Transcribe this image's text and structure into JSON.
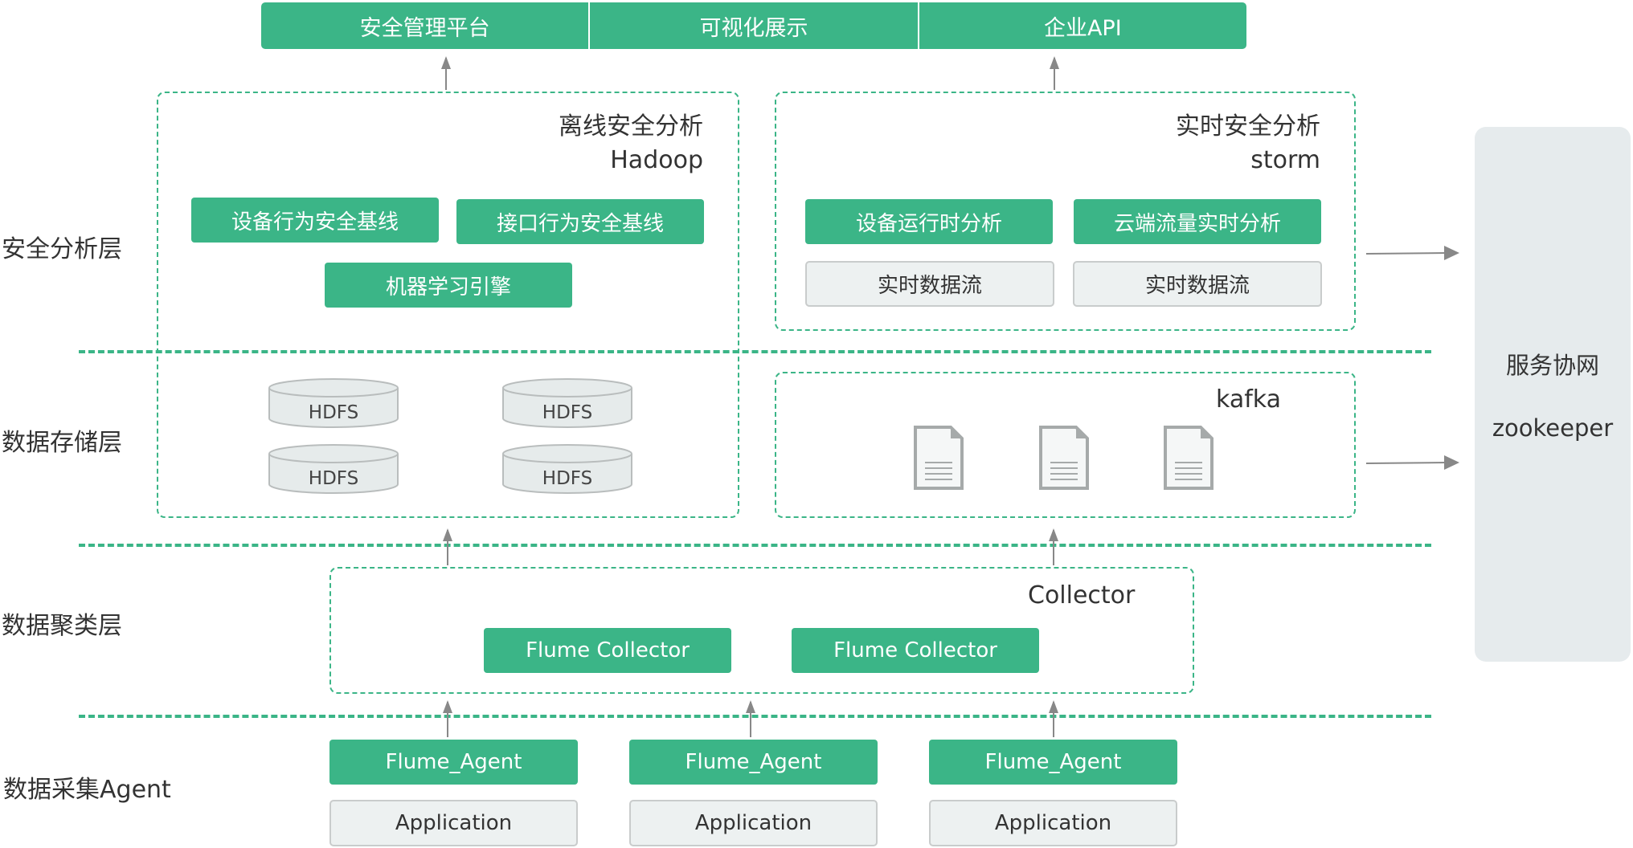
{
  "top_banner": {
    "items": [
      "安全管理平台",
      "可视化展示",
      "企业API"
    ]
  },
  "layers": [
    {
      "label": "安全分析层"
    },
    {
      "label": "数据存储层"
    },
    {
      "label": "数据聚类层"
    },
    {
      "label": "数据采集Agent"
    }
  ],
  "offline": {
    "title": "离线安全分析",
    "subtitle": "Hadoop",
    "modules": [
      "设备行为安全基线",
      "接口行为安全基线",
      "机器学习引擎"
    ],
    "storage": [
      "HDFS",
      "HDFS",
      "HDFS",
      "HDFS"
    ]
  },
  "realtime": {
    "title": "实时安全分析",
    "subtitle": "storm",
    "modules": [
      "设备运行时分析",
      "云端流量实时分析"
    ],
    "streams": [
      "实时数据流",
      "实时数据流"
    ]
  },
  "kafka": {
    "title": "kafka",
    "files": [
      "document-icon",
      "document-icon",
      "document-icon"
    ]
  },
  "collector": {
    "title": "Collector",
    "items": [
      "Flume Collector",
      "Flume Collector"
    ]
  },
  "agents": [
    {
      "agent": "Flume_Agent",
      "app": "Application"
    },
    {
      "agent": "Flume_Agent",
      "app": "Application"
    },
    {
      "agent": "Flume_Agent",
      "app": "Application"
    }
  ],
  "coordination": {
    "title": "服务协网",
    "subtitle": "zookeeper"
  },
  "colors": {
    "accent": "#3bb587",
    "box_gray": "#edf1f1",
    "panel_gray": "#e6ebed",
    "arrow": "#888888"
  }
}
